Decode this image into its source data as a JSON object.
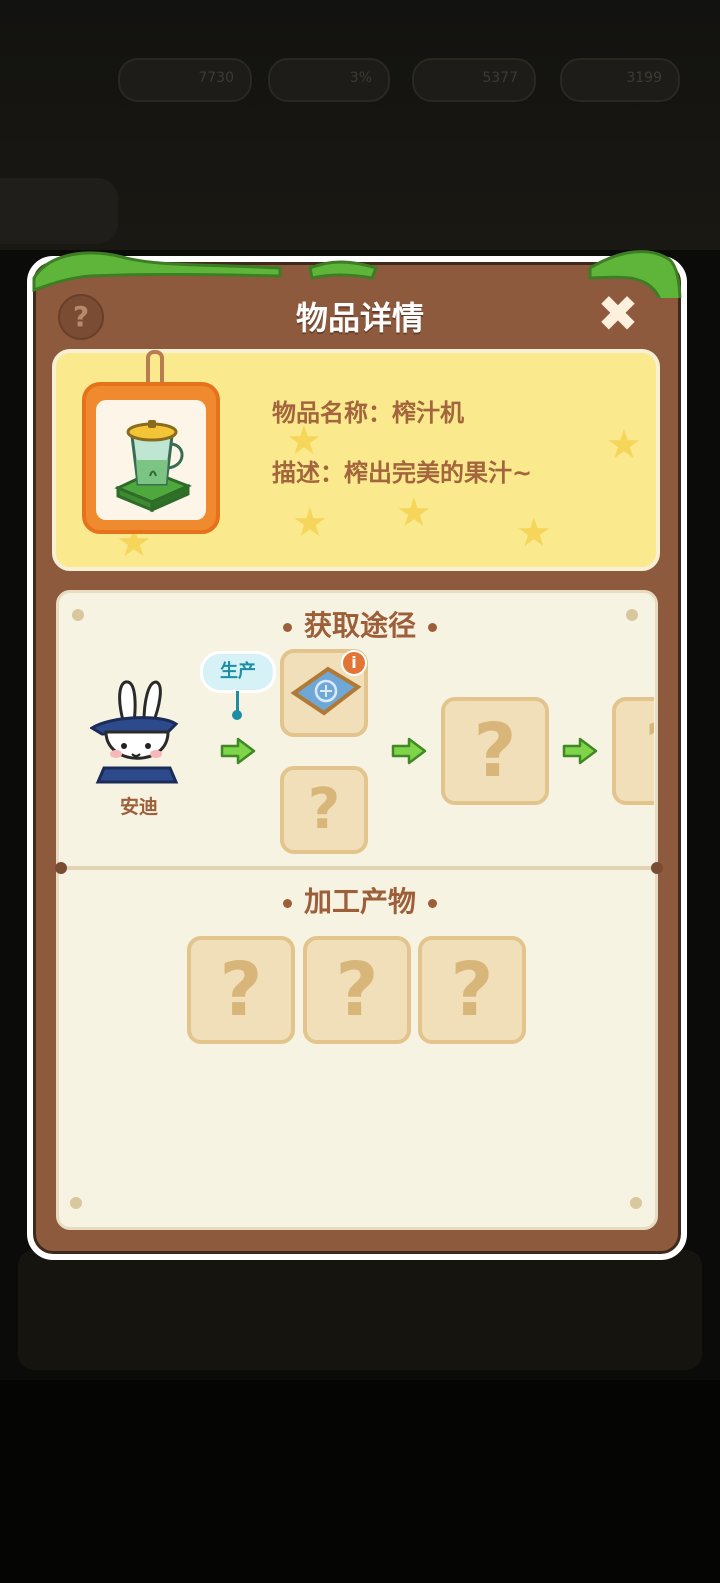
{
  "background": {
    "resources": [
      "7730",
      "3%",
      "5377",
      "3199"
    ]
  },
  "modal": {
    "title": "物品详情",
    "help_symbol": "?",
    "close_symbol": "✖"
  },
  "item": {
    "name_label": "物品名称：榨汁机",
    "desc_label": "描述：榨出完美的果汁~",
    "icon": "juicer-icon"
  },
  "obtain": {
    "title": "获取途径",
    "npc_name": "安迪",
    "bubble_label": "生产",
    "info_badge": "i",
    "unknown_symbol": "?"
  },
  "products": {
    "title": "加工产物",
    "unknown_symbol": "?"
  },
  "colors": {
    "modal_brown": "#8e5a3e",
    "card_yellow": "#fbe98e",
    "panel_cream": "#f7f3e2",
    "arrow_green": "#7fd44a",
    "accent_text": "#9c5f3a"
  }
}
